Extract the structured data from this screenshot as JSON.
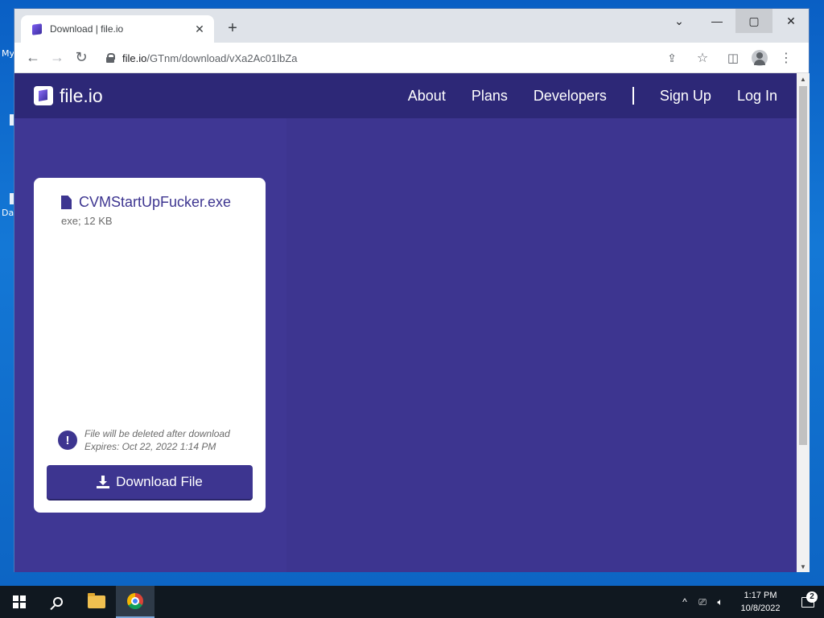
{
  "desktop": {
    "icons": [
      {
        "label": "My"
      },
      {
        "label": "Da"
      }
    ]
  },
  "browser": {
    "tab": {
      "title": "Download | file.io"
    },
    "address": {
      "host": "file.io",
      "path": "/GTnm/download/vXa2Ac01lbZa"
    }
  },
  "site": {
    "logo_text": "file.io",
    "nav": [
      {
        "label": "About"
      },
      {
        "label": "Plans"
      },
      {
        "label": "Developers"
      },
      {
        "label": "Sign Up"
      },
      {
        "label": "Log In"
      }
    ]
  },
  "file": {
    "name": "CVMStartUpFucker.exe",
    "meta": "exe; 12 KB",
    "notice_line1": "File will be deleted after download",
    "notice_line2": "Expires: Oct 22, 2022 1:14 PM",
    "download_label": "Download File"
  },
  "taskbar": {
    "time": "1:17 PM",
    "date": "10/8/2022",
    "notification_count": "2"
  },
  "colors": {
    "brand": "#3d3590",
    "nav_bg": "#2d2877",
    "desktop": "#0a5fc4"
  }
}
